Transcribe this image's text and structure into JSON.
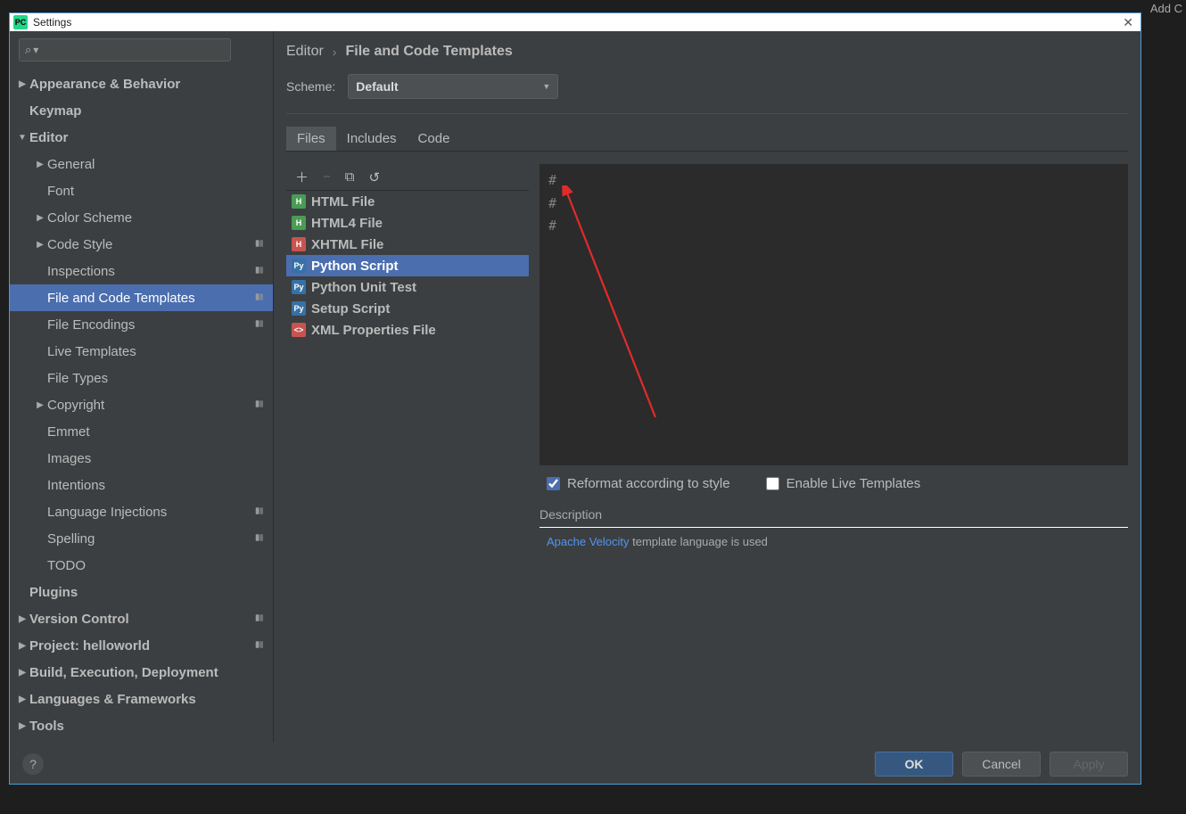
{
  "window": {
    "pc_badge": "PC",
    "title": "Settings",
    "close": "✕",
    "bg_toolbar_right": "Add C"
  },
  "search": {
    "placeholder": "",
    "lens": "⌕",
    "caret": "▾"
  },
  "tree": [
    {
      "label": "Appearance & Behavior",
      "level": 0,
      "arrow": "▶"
    },
    {
      "label": "Keymap",
      "level": 0
    },
    {
      "label": "Editor",
      "level": 0,
      "arrow": "▼"
    },
    {
      "label": "General",
      "level": 1,
      "arrow": "▶"
    },
    {
      "label": "Font",
      "level": 1
    },
    {
      "label": "Color Scheme",
      "level": 1,
      "arrow": "▶"
    },
    {
      "label": "Code Style",
      "level": 1,
      "arrow": "▶",
      "tag": true
    },
    {
      "label": "Inspections",
      "level": 1,
      "tag": true
    },
    {
      "label": "File and Code Templates",
      "level": 1,
      "sel": true,
      "tag": true
    },
    {
      "label": "File Encodings",
      "level": 1,
      "tag": true
    },
    {
      "label": "Live Templates",
      "level": 1
    },
    {
      "label": "File Types",
      "level": 1
    },
    {
      "label": "Copyright",
      "level": 1,
      "arrow": "▶",
      "tag": true
    },
    {
      "label": "Emmet",
      "level": 1
    },
    {
      "label": "Images",
      "level": 1
    },
    {
      "label": "Intentions",
      "level": 1
    },
    {
      "label": "Language Injections",
      "level": 1,
      "tag": true
    },
    {
      "label": "Spelling",
      "level": 1,
      "tag": true
    },
    {
      "label": "TODO",
      "level": 1
    },
    {
      "label": "Plugins",
      "level": 0
    },
    {
      "label": "Version Control",
      "level": 0,
      "arrow": "▶",
      "tag": true
    },
    {
      "label": "Project: helloworld",
      "level": 0,
      "arrow": "▶",
      "tag": true
    },
    {
      "label": "Build, Execution, Deployment",
      "level": 0,
      "arrow": "▶"
    },
    {
      "label": "Languages & Frameworks",
      "level": 0,
      "arrow": "▶"
    },
    {
      "label": "Tools",
      "level": 0,
      "arrow": "▶"
    }
  ],
  "breadcrumb": {
    "root": "Editor",
    "sep": "›",
    "leaf": "File and Code Templates"
  },
  "scheme": {
    "label": "Scheme:",
    "value": "Default",
    "caret": "▼"
  },
  "tabs": [
    {
      "label": "Files",
      "active": true
    },
    {
      "label": "Includes"
    },
    {
      "label": "Code"
    }
  ],
  "toolbar": {
    "add": "＋",
    "remove": "−",
    "copy": "⧉",
    "reset": "↺"
  },
  "templates": [
    {
      "label": "HTML File",
      "ico": "h",
      "glyph": "H"
    },
    {
      "label": "HTML4 File",
      "ico": "h4",
      "glyph": "H"
    },
    {
      "label": "XHTML File",
      "ico": "x",
      "glyph": "H"
    },
    {
      "label": "Python Script",
      "ico": "py",
      "glyph": "Py",
      "sel": true
    },
    {
      "label": "Python Unit Test",
      "ico": "py",
      "glyph": "Py"
    },
    {
      "label": "Setup Script",
      "ico": "py",
      "glyph": "Py"
    },
    {
      "label": "XML Properties File",
      "ico": "xml",
      "glyph": "<>"
    }
  ],
  "editor_lines": [
    "#",
    "#",
    "#"
  ],
  "checks": {
    "reformat": "Reformat according to style",
    "reformat_checked": true,
    "live": "Enable Live Templates",
    "live_checked": false
  },
  "description": {
    "label": "Description",
    "link": "Apache Velocity",
    "rest": " template language is used"
  },
  "footer": {
    "help": "?",
    "ok": "OK",
    "cancel": "Cancel",
    "apply": "Apply"
  }
}
